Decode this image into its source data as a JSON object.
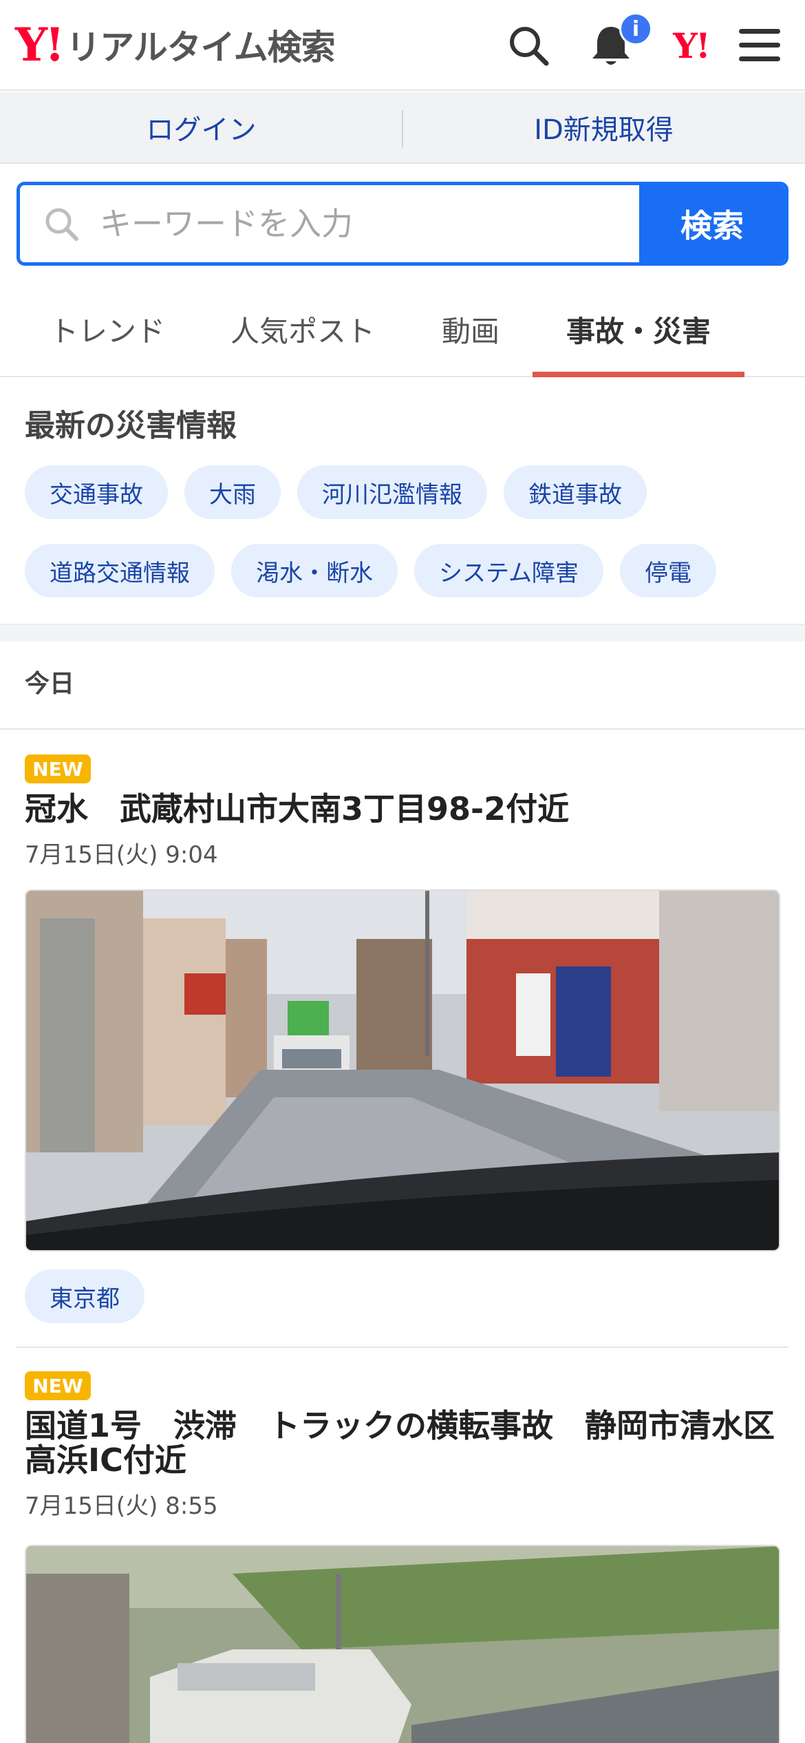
{
  "header": {
    "logo_mark": "Y!",
    "logo_text": "リアルタイム検索",
    "notification_badge": "i",
    "yj_mark": "Y!"
  },
  "loginbar": {
    "login": "ログイン",
    "register": "ID新規取得"
  },
  "search": {
    "placeholder": "キーワードを入力",
    "button": "検索"
  },
  "tabs": [
    {
      "label": "トレンド",
      "active": false
    },
    {
      "label": "人気ポスト",
      "active": false
    },
    {
      "label": "動画",
      "active": false
    },
    {
      "label": "事故・災害",
      "active": true
    }
  ],
  "disaster": {
    "title": "最新の災害情報",
    "chips": [
      "交通事故",
      "大雨",
      "河川氾濫情報",
      "鉄道事故",
      "道路交通情報",
      "渇水・断水",
      "システム障害",
      "停電"
    ]
  },
  "today_label": "今日",
  "articles": [
    {
      "badge": "NEW",
      "title": "冠水　武蔵村山市大南3丁目98-2付近",
      "time": "7月15日(火) 9:04",
      "location": "東京都"
    },
    {
      "badge": "NEW",
      "title": "国道1号　渋滞　トラックの横転事故　静岡市清水区　高浜IC付近",
      "time": "7月15日(火) 8:55"
    }
  ],
  "colors": {
    "brand_red": "#ff0033",
    "accent_blue": "#1a6ef5",
    "tab_underline": "#e0584a",
    "new_badge": "#f7b500"
  }
}
